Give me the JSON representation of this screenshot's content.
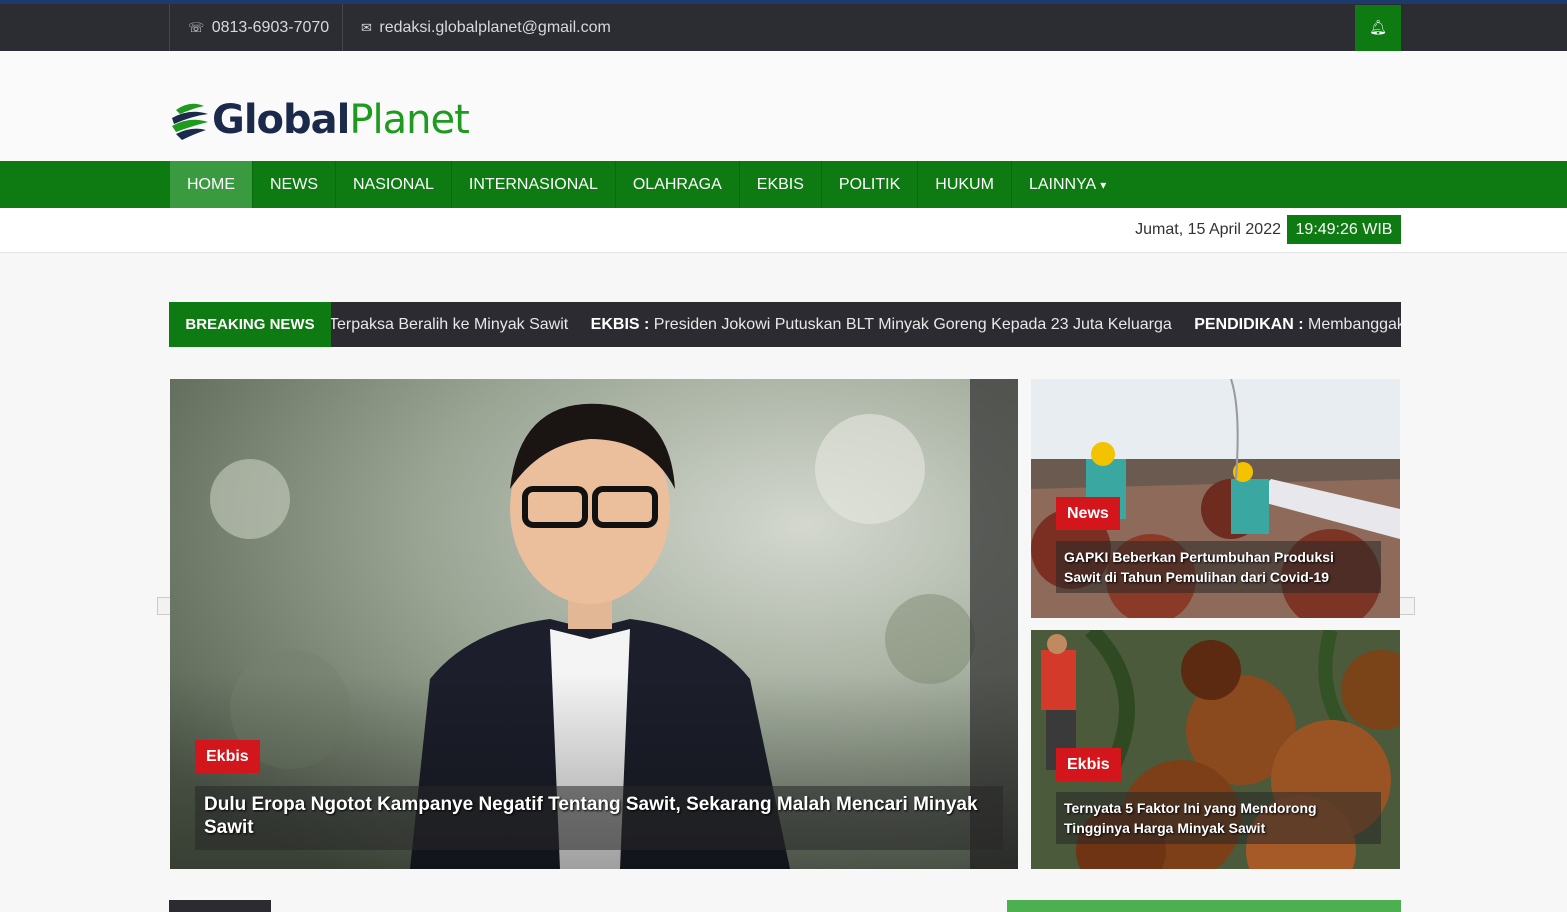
{
  "topbar": {
    "phone_icon": "phone-icon",
    "phone": "0813-6903-7070",
    "email_icon": "envelope-icon",
    "email": "redaksi.globalplanet@gmail.com",
    "notification_icon": "bell-icon"
  },
  "brand": {
    "part1": "Global",
    "part2": "Planet",
    "color_dark": "#1b2a4a",
    "color_green": "#1e9a1e"
  },
  "nav": {
    "items": [
      "HOME",
      "NEWS",
      "NASIONAL",
      "INTERNASIONAL",
      "OLAHRAGA",
      "EKBIS",
      "POLITIK",
      "HUKUM",
      "LAINNYA"
    ],
    "active": "HOME",
    "caret_icon": "chevron-down-icon"
  },
  "datebar": {
    "date": "Jumat, 15 April 2022",
    "time": "19:49:26 WIB"
  },
  "breaking": {
    "label": "BREAKING NEWS",
    "items": [
      {
        "category": "",
        "text": "Terpaksa Beralih ke Minyak Sawit"
      },
      {
        "category": "EKBIS :",
        "text": "Presiden Jokowi Putuskan BLT Minyak Goreng Kepada 23 Juta Keluarga"
      },
      {
        "category": "PENDIDIKAN :",
        "text": "Membanggakan"
      }
    ]
  },
  "featured": {
    "main": {
      "category": "Ekbis",
      "title": "Dulu Eropa Ngotot Kampanye Negatif Tentang Sawit, Sekarang Malah Mencari Minyak Sawit"
    },
    "side": [
      {
        "category": "News",
        "title": "GAPKI Beberkan Pertumbuhan Produksi Sawit di Tahun Pemulihan dari Covid-19"
      },
      {
        "category": "Ekbis",
        "title": "Ternyata 5 Faktor Ini yang Mendorong Tingginya Harga Minyak Sawit"
      }
    ]
  },
  "colors": {
    "primary_green": "#0d7a12",
    "badge_red": "#d2161c",
    "dark_bar": "#2c2c33"
  }
}
